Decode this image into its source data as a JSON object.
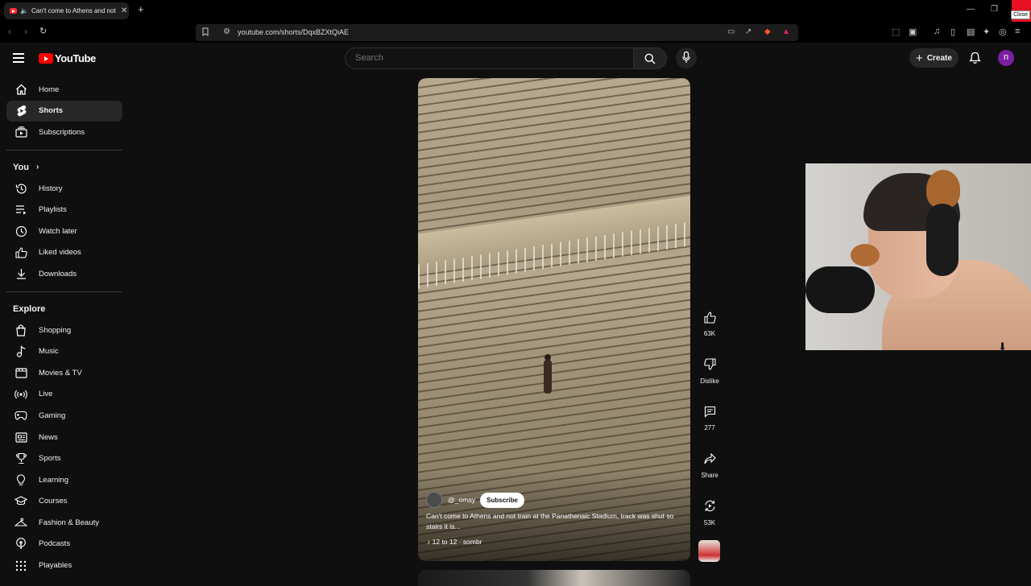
{
  "browser": {
    "tab_title": "Can't come to Athens and not train",
    "url": "youtube.com/shorts/DqxBZXtQiAE",
    "close_tooltip": "Close"
  },
  "header": {
    "logo_text": "YouTube",
    "search_placeholder": "Search",
    "create_label": "Create",
    "avatar_letter": "n"
  },
  "sidebar": {
    "main": [
      {
        "label": "Home",
        "icon": "home-icon"
      },
      {
        "label": "Shorts",
        "icon": "shorts-icon",
        "active": true
      },
      {
        "label": "Subscriptions",
        "icon": "subscriptions-icon"
      }
    ],
    "you_heading": "You",
    "you": [
      {
        "label": "History",
        "icon": "history-icon"
      },
      {
        "label": "Playlists",
        "icon": "playlists-icon"
      },
      {
        "label": "Watch later",
        "icon": "watch-later-icon"
      },
      {
        "label": "Liked videos",
        "icon": "liked-videos-icon"
      },
      {
        "label": "Downloads",
        "icon": "downloads-icon"
      }
    ],
    "explore_heading": "Explore",
    "explore": [
      {
        "label": "Shopping",
        "icon": "shopping-icon"
      },
      {
        "label": "Music",
        "icon": "music-icon"
      },
      {
        "label": "Movies & TV",
        "icon": "movies-icon"
      },
      {
        "label": "Live",
        "icon": "live-icon"
      },
      {
        "label": "Gaming",
        "icon": "gaming-icon"
      },
      {
        "label": "News",
        "icon": "news-icon"
      },
      {
        "label": "Sports",
        "icon": "sports-icon"
      },
      {
        "label": "Learning",
        "icon": "learning-icon"
      },
      {
        "label": "Courses",
        "icon": "courses-icon"
      },
      {
        "label": "Fashion & Beauty",
        "icon": "fashion-icon"
      },
      {
        "label": "Podcasts",
        "icon": "podcasts-icon"
      },
      {
        "label": "Playables",
        "icon": "playables-icon"
      }
    ]
  },
  "short": {
    "channel": "@_omay",
    "subscribe_label": "Subscribe",
    "caption": "Can't come to Athens and not train at the Panathenaic Stadium, track was shut so stairs it is...",
    "music": "12 to 12 · sombr"
  },
  "actions": {
    "likes": "63K",
    "dislike": "Dislike",
    "comments": "277",
    "share": "Share",
    "remix": "53K"
  },
  "colors": {
    "brand_red": "#ff0000",
    "background": "#0f0f0f",
    "avatar": "#7b1fa2"
  }
}
